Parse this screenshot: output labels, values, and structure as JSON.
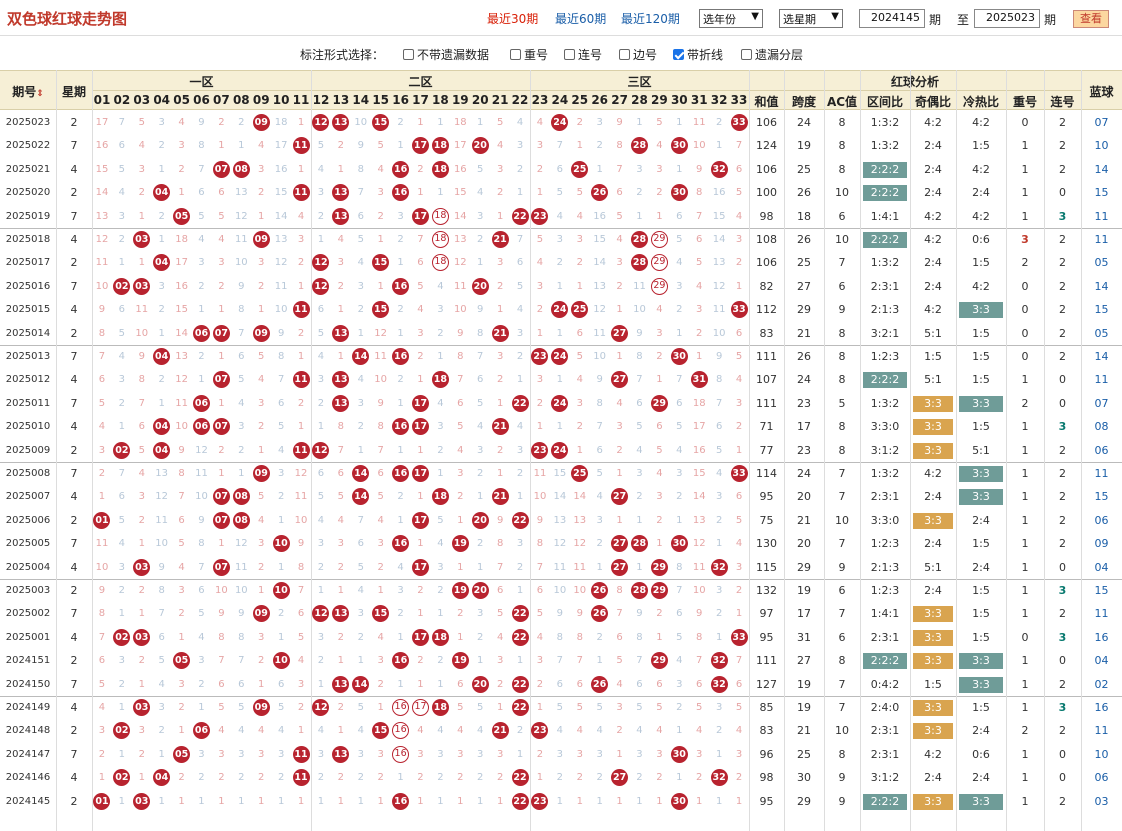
{
  "title": "双色球红球走势图",
  "period_links": [
    {
      "label": "最近30期",
      "color": "#d81e06"
    },
    {
      "label": "最近60期",
      "color": "#1a5ea8"
    },
    {
      "label": "最近120期",
      "color": "#1a5ea8"
    }
  ],
  "year_select": "选年份",
  "week_select": "选星期",
  "from_value": "2024145",
  "from_unit": "期",
  "to_label": "至",
  "to_value": "2025023",
  "to_unit": "期",
  "query_button": "查看",
  "options_label": "标注形式选择：",
  "options": [
    {
      "label": "不带遗漏数据",
      "checked": false
    },
    {
      "label": "重号",
      "checked": false
    },
    {
      "label": "连号",
      "checked": false
    },
    {
      "label": "边号",
      "checked": false
    },
    {
      "label": "带折线",
      "checked": true
    },
    {
      "label": "遗漏分层",
      "checked": false
    }
  ],
  "headers": {
    "issue": "期号",
    "sort_icon": "sort-arrow",
    "week": "星期",
    "zone1": "一区",
    "zone2": "二区",
    "zone3": "三区",
    "analysis": "红球分析",
    "blue": "蓝球",
    "sum": "和值",
    "span": "跨度",
    "ac": "AC值",
    "zone_ratio": "区间比",
    "odd_even": "奇偶比",
    "hot_cold": "冷热比",
    "repeat": "重号",
    "consec": "连号"
  },
  "numbers": [
    "01",
    "02",
    "03",
    "04",
    "05",
    "06",
    "07",
    "08",
    "09",
    "10",
    "11",
    "12",
    "13",
    "14",
    "15",
    "16",
    "17",
    "18",
    "19",
    "20",
    "21",
    "22",
    "23",
    "24",
    "25",
    "26",
    "27",
    "28",
    "29",
    "30",
    "31",
    "32",
    "33"
  ],
  "colors": {
    "ball": "#b8232f",
    "zone_tag": "#6f9c98",
    "odd_tag": "#d9a44f",
    "hot_tag": "#6f9c98",
    "header_bg": "#f6efd6"
  },
  "rows": [
    {
      "issue": "2025023",
      "week": "2",
      "reds": [
        "09",
        "12",
        "13",
        "15",
        "24",
        "33"
      ],
      "sum": "106",
      "span": "24",
      "ac": "8",
      "zr": "1:3:2",
      "oe": "4:2",
      "hc": "4:2",
      "rep": "0",
      "con": "2",
      "blue": "07"
    },
    {
      "issue": "2025022",
      "week": "7",
      "reds": [
        "11",
        "17",
        "18",
        "20",
        "28",
        "30"
      ],
      "sum": "124",
      "span": "19",
      "ac": "8",
      "zr": "1:3:2",
      "oe": "2:4",
      "hc": "1:5",
      "rep": "1",
      "con": "2",
      "blue": "10"
    },
    {
      "issue": "2025021",
      "week": "4",
      "reds": [
        "07",
        "08",
        "16",
        "18",
        "25",
        "32"
      ],
      "sum": "106",
      "span": "25",
      "ac": "8",
      "zr": "2:2:2",
      "oe": "2:4",
      "hc": "4:2",
      "rep": "1",
      "con": "2",
      "blue": "14"
    },
    {
      "issue": "2025020",
      "week": "2",
      "reds": [
        "04",
        "11",
        "13",
        "16",
        "26",
        "30"
      ],
      "sum": "100",
      "span": "26",
      "ac": "10",
      "zr": "2:2:2",
      "oe": "2:4",
      "hc": "2:4",
      "rep": "1",
      "con": "0",
      "blue": "15"
    },
    {
      "issue": "2025019",
      "week": "7",
      "reds": [
        "05",
        "13",
        "17",
        "18",
        "22",
        "23"
      ],
      "sum": "98",
      "span": "18",
      "ac": "6",
      "zr": "1:4:1",
      "oe": "4:2",
      "hc": "4:2",
      "rep": "1",
      "con": "3",
      "blue": "11"
    },
    {
      "issue": "2025018",
      "week": "4",
      "reds": [
        "03",
        "09",
        "18",
        "21",
        "28",
        "29"
      ],
      "sum": "108",
      "span": "26",
      "ac": "10",
      "zr": "2:2:2",
      "oe": "4:2",
      "hc": "0:6",
      "rep": "3",
      "con": "2",
      "blue": "11"
    },
    {
      "issue": "2025017",
      "week": "2",
      "reds": [
        "04",
        "12",
        "15",
        "18",
        "28",
        "29"
      ],
      "sum": "106",
      "span": "25",
      "ac": "7",
      "zr": "1:3:2",
      "oe": "2:4",
      "hc": "1:5",
      "rep": "2",
      "con": "2",
      "blue": "05"
    },
    {
      "issue": "2025016",
      "week": "7",
      "reds": [
        "02",
        "03",
        "12",
        "16",
        "20",
        "29"
      ],
      "sum": "82",
      "span": "27",
      "ac": "6",
      "zr": "2:3:1",
      "oe": "2:4",
      "hc": "4:2",
      "rep": "0",
      "con": "2",
      "blue": "14"
    },
    {
      "issue": "2025015",
      "week": "4",
      "reds": [
        "11",
        "15",
        "24",
        "25",
        "33"
      ],
      "sum": "112",
      "span": "29",
      "ac": "9",
      "zr": "2:1:3",
      "oe": "4:2",
      "hc": "3:3",
      "rep": "0",
      "con": "2",
      "blue": "15"
    },
    {
      "issue": "2025014",
      "week": "2",
      "reds": [
        "06",
        "07",
        "09",
        "13",
        "21",
        "27"
      ],
      "sum": "83",
      "span": "21",
      "ac": "8",
      "zr": "3:2:1",
      "oe": "5:1",
      "hc": "1:5",
      "rep": "0",
      "con": "2",
      "blue": "05"
    },
    {
      "issue": "2025013",
      "week": "7",
      "reds": [
        "04",
        "14",
        "16",
        "23",
        "24",
        "30"
      ],
      "sum": "111",
      "span": "26",
      "ac": "8",
      "zr": "1:2:3",
      "oe": "1:5",
      "hc": "1:5",
      "rep": "0",
      "con": "2",
      "blue": "14"
    },
    {
      "issue": "2025012",
      "week": "4",
      "reds": [
        "07",
        "11",
        "13",
        "18",
        "27",
        "31"
      ],
      "sum": "107",
      "span": "24",
      "ac": "8",
      "zr": "2:2:2",
      "oe": "5:1",
      "hc": "1:5",
      "rep": "1",
      "con": "0",
      "blue": "11"
    },
    {
      "issue": "2025011",
      "week": "7",
      "reds": [
        "06",
        "13",
        "17",
        "22",
        "24",
        "29"
      ],
      "sum": "111",
      "span": "23",
      "ac": "5",
      "zr": "1:3:2",
      "oe": "3:3",
      "hc": "3:3",
      "rep": "2",
      "con": "0",
      "blue": "07"
    },
    {
      "issue": "2025010",
      "week": "4",
      "reds": [
        "04",
        "06",
        "07",
        "16",
        "17",
        "21"
      ],
      "sum": "71",
      "span": "17",
      "ac": "8",
      "zr": "3:3:0",
      "oe": "3:3",
      "hc": "1:5",
      "rep": "1",
      "con": "3",
      "blue": "08"
    },
    {
      "issue": "2025009",
      "week": "2",
      "reds": [
        "02",
        "04",
        "11",
        "12",
        "23",
        "24"
      ],
      "sum": "77",
      "span": "23",
      "ac": "8",
      "zr": "3:1:2",
      "oe": "3:3",
      "hc": "5:1",
      "rep": "1",
      "con": "2",
      "blue": "06"
    },
    {
      "issue": "2025008",
      "week": "7",
      "reds": [
        "09",
        "14",
        "16",
        "17",
        "25",
        "33"
      ],
      "sum": "114",
      "span": "24",
      "ac": "7",
      "zr": "1:3:2",
      "oe": "4:2",
      "hc": "3:3",
      "rep": "1",
      "con": "2",
      "blue": "11"
    },
    {
      "issue": "2025007",
      "week": "4",
      "reds": [
        "07",
        "08",
        "14",
        "18",
        "21",
        "27"
      ],
      "sum": "95",
      "span": "20",
      "ac": "7",
      "zr": "2:3:1",
      "oe": "2:4",
      "hc": "3:3",
      "rep": "1",
      "con": "2",
      "blue": "15"
    },
    {
      "issue": "2025006",
      "week": "2",
      "reds": [
        "01",
        "07",
        "08",
        "17",
        "20",
        "22"
      ],
      "sum": "75",
      "span": "21",
      "ac": "10",
      "zr": "3:3:0",
      "oe": "3:3",
      "hc": "2:4",
      "rep": "1",
      "con": "2",
      "blue": "06"
    },
    {
      "issue": "2025005",
      "week": "7",
      "reds": [
        "10",
        "16",
        "19",
        "27",
        "28",
        "30"
      ],
      "sum": "130",
      "span": "20",
      "ac": "7",
      "zr": "1:2:3",
      "oe": "2:4",
      "hc": "1:5",
      "rep": "1",
      "con": "2",
      "blue": "09"
    },
    {
      "issue": "2025004",
      "week": "4",
      "reds": [
        "03",
        "07",
        "17",
        "27",
        "29",
        "32"
      ],
      "sum": "115",
      "span": "29",
      "ac": "9",
      "zr": "2:1:3",
      "oe": "5:1",
      "hc": "2:4",
      "rep": "1",
      "con": "0",
      "blue": "04"
    },
    {
      "issue": "2025003",
      "week": "2",
      "reds": [
        "10",
        "19",
        "20",
        "26",
        "28",
        "29"
      ],
      "sum": "132",
      "span": "19",
      "ac": "6",
      "zr": "1:2:3",
      "oe": "2:4",
      "hc": "1:5",
      "rep": "1",
      "con": "3",
      "blue": "15"
    },
    {
      "issue": "2025002",
      "week": "7",
      "reds": [
        "09",
        "12",
        "13",
        "15",
        "22",
        "26"
      ],
      "sum": "97",
      "span": "17",
      "ac": "7",
      "zr": "1:4:1",
      "oe": "3:3",
      "hc": "1:5",
      "rep": "1",
      "con": "2",
      "blue": "11"
    },
    {
      "issue": "2025001",
      "week": "4",
      "reds": [
        "02",
        "03",
        "17",
        "18",
        "22",
        "33"
      ],
      "sum": "95",
      "span": "31",
      "ac": "6",
      "zr": "2:3:1",
      "oe": "3:3",
      "hc": "1:5",
      "rep": "0",
      "con": "3",
      "blue": "16"
    },
    {
      "issue": "2024151",
      "week": "2",
      "reds": [
        "05",
        "10",
        "16",
        "19",
        "29",
        "32"
      ],
      "sum": "111",
      "span": "27",
      "ac": "8",
      "zr": "2:2:2",
      "oe": "3:3",
      "hc": "3:3",
      "rep": "1",
      "con": "0",
      "blue": "04"
    },
    {
      "issue": "2024150",
      "week": "7",
      "reds": [
        "13",
        "14",
        "20",
        "22",
        "26",
        "32"
      ],
      "sum": "127",
      "span": "19",
      "ac": "7",
      "zr": "0:4:2",
      "oe": "1:5",
      "hc": "3:3",
      "rep": "1",
      "con": "2",
      "blue": "02"
    },
    {
      "issue": "2024149",
      "week": "4",
      "reds": [
        "03",
        "09",
        "12",
        "16",
        "17",
        "18",
        "22"
      ],
      "sum": "85",
      "span": "19",
      "ac": "7",
      "zr": "2:4:0",
      "oe": "3:3",
      "hc": "1:5",
      "rep": "1",
      "con": "3",
      "blue": "16"
    },
    {
      "issue": "2024148",
      "week": "2",
      "reds": [
        "02",
        "06",
        "15",
        "16",
        "21",
        "23"
      ],
      "sum": "83",
      "span": "21",
      "ac": "10",
      "zr": "2:3:1",
      "oe": "3:3",
      "hc": "2:4",
      "rep": "2",
      "con": "2",
      "blue": "11"
    },
    {
      "issue": "2024147",
      "week": "7",
      "reds": [
        "05",
        "11",
        "13",
        "16",
        "30"
      ],
      "sum": "96",
      "span": "25",
      "ac": "8",
      "zr": "2:3:1",
      "oe": "4:2",
      "hc": "0:6",
      "rep": "1",
      "con": "0",
      "blue": "10"
    },
    {
      "issue": "2024146",
      "week": "4",
      "reds": [
        "02",
        "04",
        "11",
        "22",
        "27",
        "32"
      ],
      "sum": "98",
      "span": "30",
      "ac": "9",
      "zr": "3:1:2",
      "oe": "2:4",
      "hc": "2:4",
      "rep": "1",
      "con": "0",
      "blue": "06"
    },
    {
      "issue": "2024145",
      "week": "2",
      "reds": [
        "01",
        "03",
        "16",
        "22",
        "23",
        "30"
      ],
      "sum": "95",
      "span": "29",
      "ac": "9",
      "zr": "2:2:2",
      "oe": "3:3",
      "hc": "3:3",
      "rep": "1",
      "con": "2",
      "blue": "03"
    }
  ]
}
